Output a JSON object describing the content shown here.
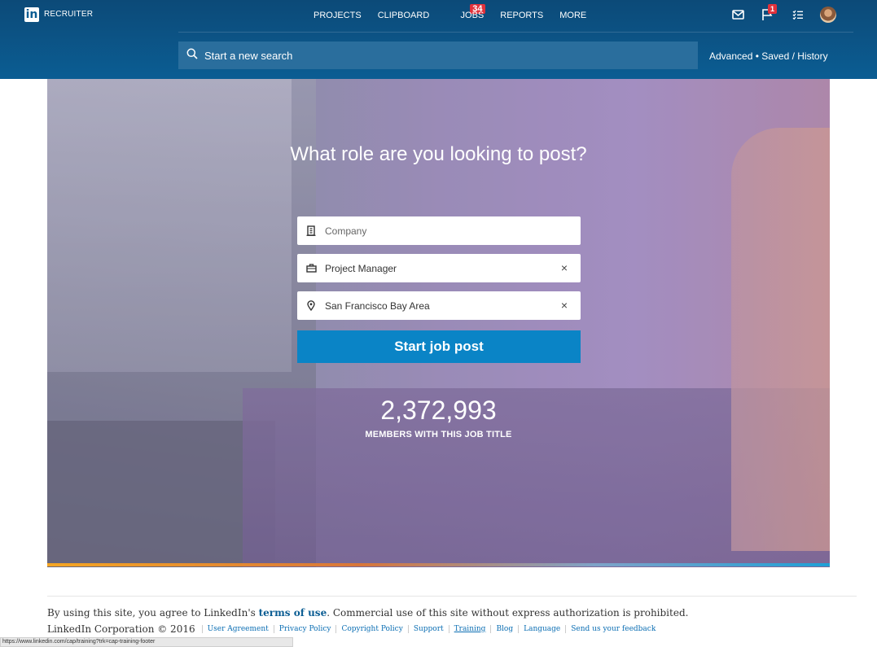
{
  "header": {
    "logo_text": "in",
    "brand": "RECRUITER",
    "nav": [
      "PROJECTS",
      "CLIPBOARD",
      "JOBS",
      "REPORTS",
      "MORE"
    ],
    "clipboard_badge": "34",
    "flag_badge": "1",
    "search_placeholder": "Start a new search",
    "advanced_link": "Advanced • Saved / History"
  },
  "hero": {
    "headline": "What role are you looking to post?",
    "company_placeholder": "Company",
    "title_value": "Project Manager",
    "location_value": "San Francisco Bay Area",
    "clear_symbol": "×",
    "cta": "Start job post",
    "member_count": "2,372,993",
    "member_label": "MEMBERS WITH THIS JOB TITLE"
  },
  "footer": {
    "terms_prefix": "By using this site, you agree to LinkedIn's ",
    "terms_link": "terms of use",
    "terms_suffix": ". Commercial use of this site without express authorization is prohibited.",
    "corp": "LinkedIn Corporation © 2016",
    "links": [
      "User Agreement",
      "Privacy Policy",
      "Copyright Policy",
      "Support",
      "Training",
      "Blog",
      "Language",
      "Send us your feedback"
    ]
  },
  "status_bar": "https://www.linkedin.com/cap/training?trk=cap-training-footer"
}
